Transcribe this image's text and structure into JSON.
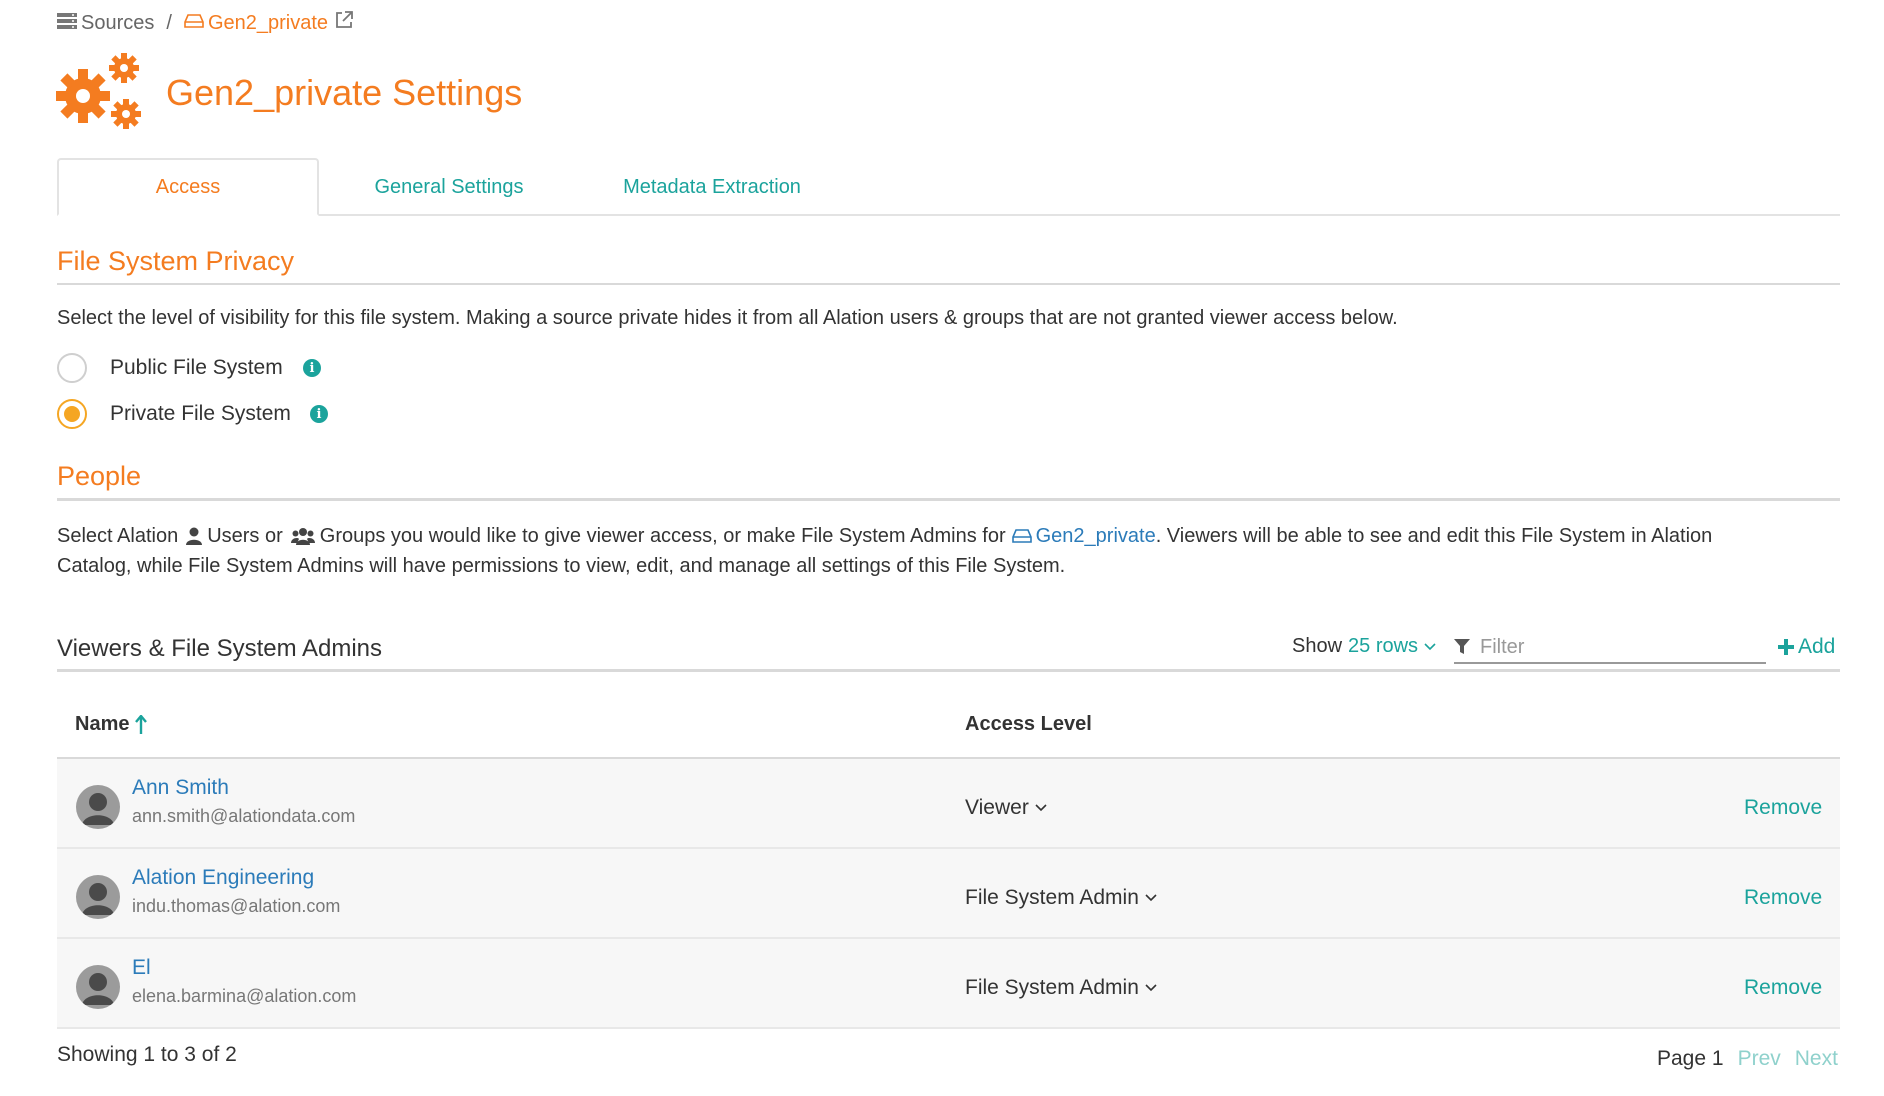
{
  "breadcrumb": {
    "root_label": "Sources",
    "separator": "/",
    "current_label": "Gen2_private"
  },
  "header": {
    "title": "Gen2_private Settings",
    "icon": "gears-icon"
  },
  "tabs": [
    {
      "label": "Access",
      "active": true
    },
    {
      "label": "General Settings",
      "active": false
    },
    {
      "label": "Metadata Extraction",
      "active": false
    }
  ],
  "privacy": {
    "title": "File System Privacy",
    "description": "Select the level of visibility for this file system. Making a source private hides it from all Alation users & groups that are not granted viewer access below.",
    "options": [
      {
        "label": "Public File System",
        "selected": false
      },
      {
        "label": "Private File System",
        "selected": true
      }
    ]
  },
  "people": {
    "title": "People",
    "desc_part1": "Select Alation",
    "desc_users": "Users or",
    "desc_groups": "Groups you would like to give viewer access, or make File System Admins for",
    "desc_link": "Gen2_private",
    "desc_part2": ". Viewers will be able to see and edit this File System in Alation",
    "desc_line2": "Catalog, while File System Admins will have permissions to view, edit, and manage all settings of this File System."
  },
  "table": {
    "title": "Viewers & File System Admins",
    "show_label": "Show",
    "rows_option": "25 rows",
    "filter_placeholder": "Filter",
    "add_label": "Add",
    "columns": [
      "Name",
      "Access Level"
    ],
    "rows": [
      {
        "name": "Ann Smith",
        "email": "ann.smith@alationdata.com",
        "access": "Viewer",
        "action": "Remove"
      },
      {
        "name": "Alation Engineering",
        "email": "indu.thomas@alation.com",
        "access": "File System Admin",
        "action": "Remove"
      },
      {
        "name": "El",
        "email": "elena.barmina@alation.com",
        "access": "File System Admin",
        "action": "Remove"
      }
    ],
    "showing": "Showing 1 to 3 of 2",
    "page_label": "Page 1",
    "prev_label": "Prev",
    "next_label": "Next"
  },
  "colors": {
    "accent": "#f47c20",
    "link": "#1ba39c",
    "name_link": "#2b7bb9"
  }
}
